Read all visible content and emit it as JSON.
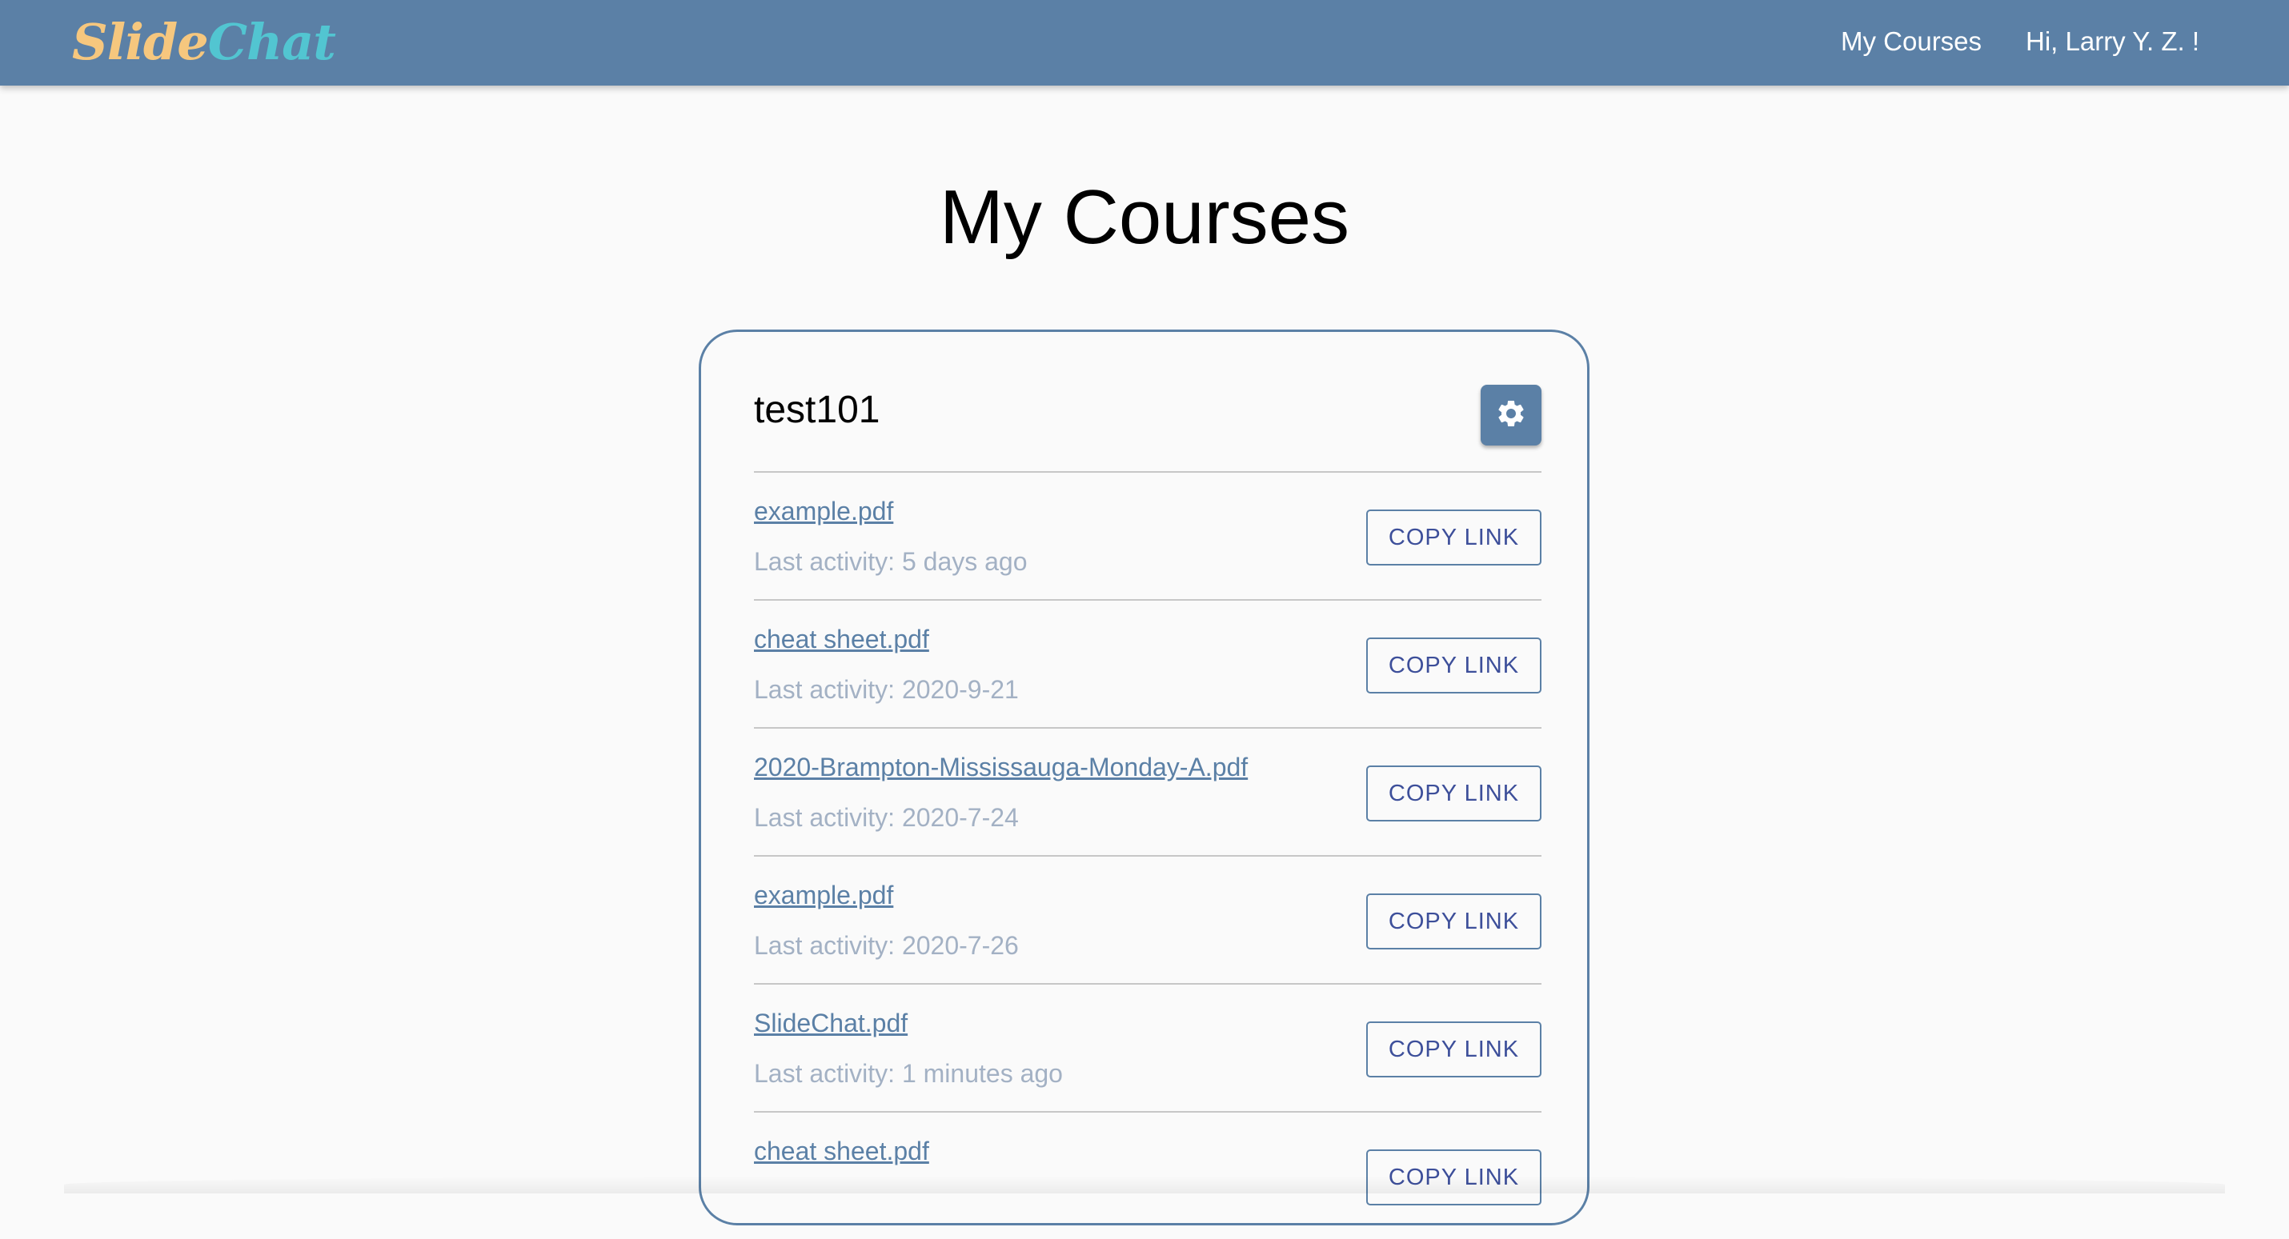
{
  "navbar": {
    "logo_part1": "Slide",
    "logo_part2": "Chat",
    "links": {
      "my_courses": "My Courses",
      "greeting": "Hi, Larry Y. Z. !"
    },
    "background_color": "#5b80a6"
  },
  "main": {
    "title": "My Courses",
    "course": {
      "name": "test101",
      "settings_icon": "gear-icon",
      "files": [
        {
          "name": "example.pdf",
          "activity": "Last activity: 5 days ago",
          "button": "COPY LINK"
        },
        {
          "name": "cheat sheet.pdf",
          "activity": "Last activity: 2020-9-21",
          "button": "COPY LINK"
        },
        {
          "name": "2020-Brampton-Mississauga-Monday-A.pdf",
          "activity": "Last activity: 2020-7-24",
          "button": "COPY LINK"
        },
        {
          "name": "example.pdf",
          "activity": "Last activity: 2020-7-26",
          "button": "COPY LINK"
        },
        {
          "name": "SlideChat.pdf",
          "activity": "Last activity: 1 minutes ago",
          "button": "COPY LINK"
        },
        {
          "name": "cheat sheet.pdf",
          "activity": "",
          "button": "COPY LINK"
        }
      ]
    }
  },
  "colors": {
    "accent": "#5b80a6",
    "logo_slide": "#f6c77e",
    "logo_chat": "#52c5d1",
    "link": "#5b80a6",
    "muted": "#a3b1c4",
    "button_text": "#3d4f9a"
  }
}
